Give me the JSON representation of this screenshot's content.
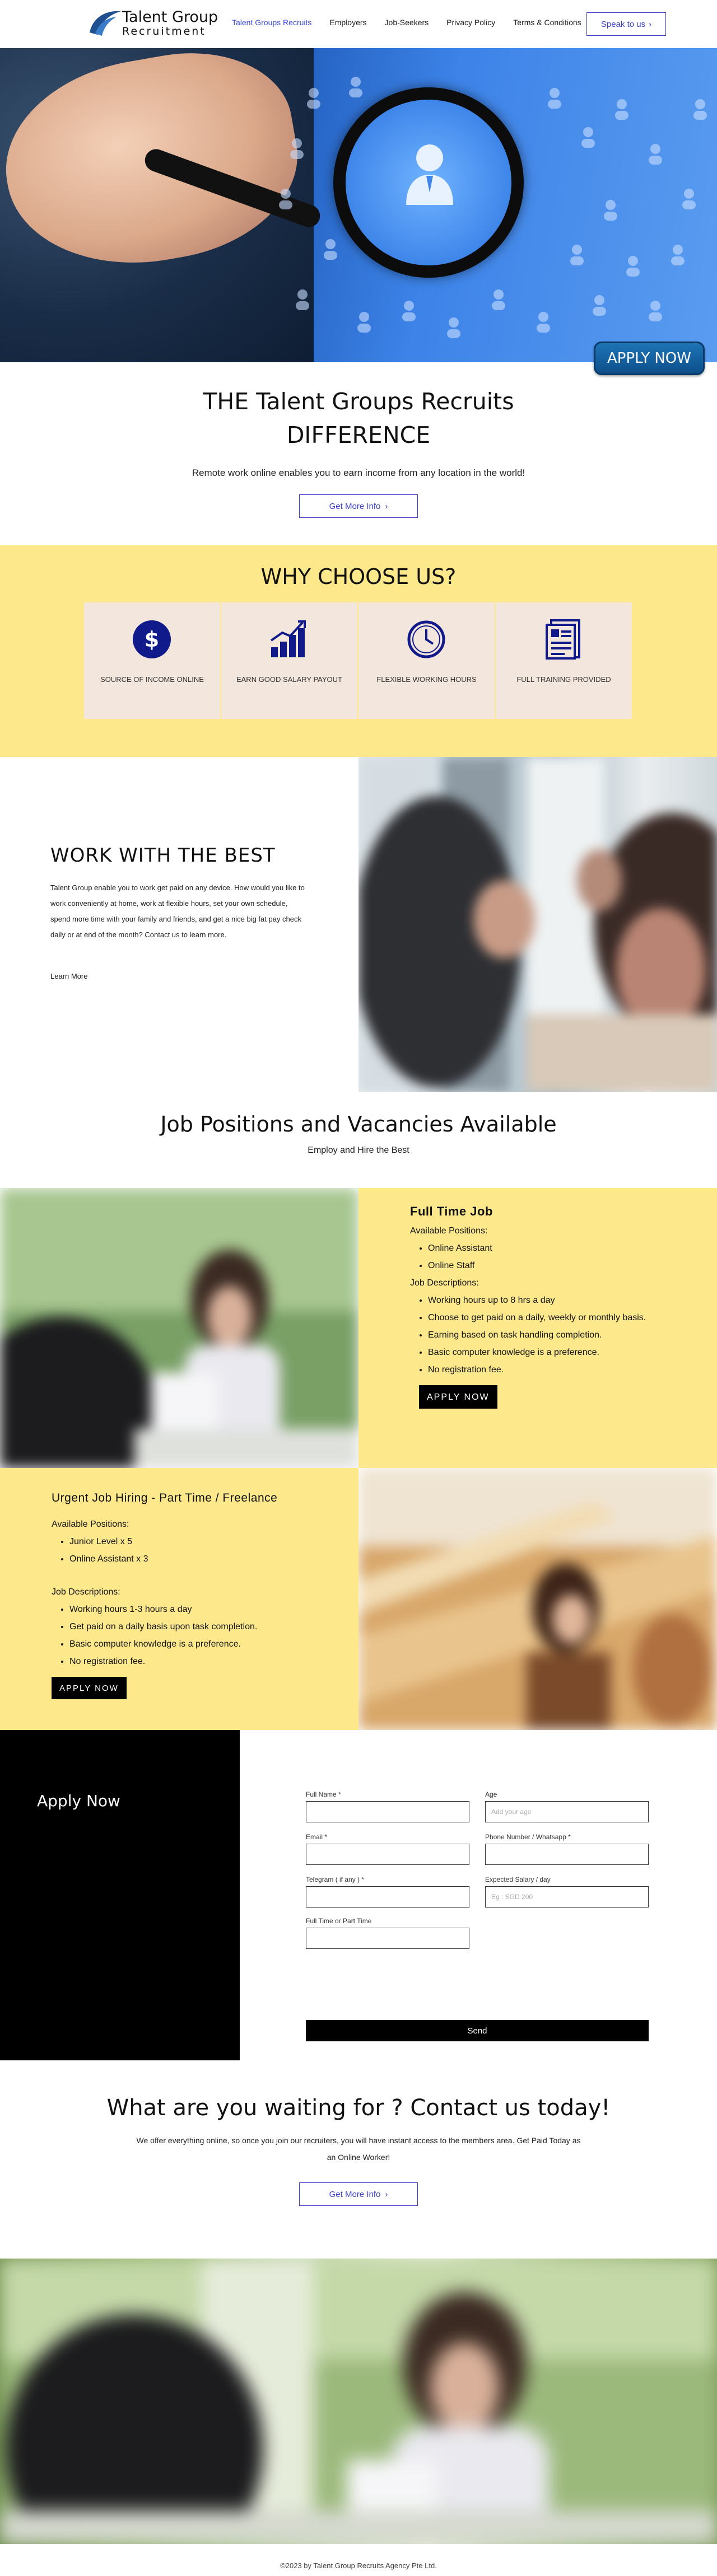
{
  "header": {
    "logo_line1": "Talent Group",
    "logo_line2": "Recruitment",
    "nav": [
      {
        "label": "Talent Groups Recruits",
        "active": true
      },
      {
        "label": "Employers",
        "active": false
      },
      {
        "label": "Job-Seekers",
        "active": false
      },
      {
        "label": "Privacy Policy",
        "active": false
      },
      {
        "label": "Terms & Conditions",
        "active": false
      }
    ],
    "speak_button": "Speak to us"
  },
  "hero": {
    "apply_now": "APPLY NOW"
  },
  "difference": {
    "title_line1": "THE Talent Groups Recruits",
    "title_line2": "DIFFERENCE",
    "subtitle": "Remote work online enables you to earn income from any location in the world!",
    "button": "Get More Info"
  },
  "why": {
    "title": "WHY CHOOSE US?",
    "cards": [
      {
        "label": "SOURCE OF INCOME ONLINE",
        "icon": "dollar-icon"
      },
      {
        "label": "EARN GOOD SALARY PAYOUT",
        "icon": "bar-chart-icon"
      },
      {
        "label": "FLEXIBLE WORKING HOURS",
        "icon": "clock-icon"
      },
      {
        "label": "FULL TRAINING PROVIDED",
        "icon": "document-icon"
      }
    ]
  },
  "work": {
    "title": "WORK WITH THE BEST",
    "body": "Talent Group enable you to work get paid on any device. How would you like to work conveniently at home, work at flexible hours, set your own schedule, spend more time with your family and friends, and get a nice big fat pay check daily or at end of the month? Contact us to learn more.",
    "learn_more": "Learn More"
  },
  "positions": {
    "title": "Job Positions and Vacancies Available",
    "subtitle": "Employ and Hire the Best"
  },
  "fulltime": {
    "title": "Full Time Job",
    "available_label": "Available Positions:",
    "positions": [
      "Online Assistant",
      "Online Staff"
    ],
    "desc_label": "Job Descriptions:",
    "descriptions": [
      "Working hours up to 8 hrs a day",
      "Choose to get paid on a daily, weekly or monthly basis.",
      "Earning based on task handling completion.",
      "Basic computer knowledge is a preference.",
      "No registration fee."
    ],
    "button": "APPLY NOW"
  },
  "urgent": {
    "title": "Urgent Job Hiring - Part Time / Freelance",
    "available_label": "Available Positions:",
    "positions": [
      "Junior Level x 5",
      "Online Assistant x 3"
    ],
    "desc_label": "Job Descriptions:",
    "descriptions": [
      "Working hours 1-3 hours a day",
      "Get paid on a daily basis upon task completion.",
      "Basic computer knowledge is a preference.",
      "No registration fee."
    ],
    "button": "APPLY NOW"
  },
  "form": {
    "title": "Apply Now",
    "full_name_label": "Full Name *",
    "age_label": "Age",
    "age_placeholder": "Add your age",
    "email_label": "Email *",
    "phone_label": "Phone Number / Whatsapp *",
    "telegram_label": "Telegram ( if any ) *",
    "salary_label": "Expected Salary / day",
    "salary_placeholder": "Eg : SGD 200",
    "jobtype_label": "Full Time or Part Time",
    "send": "Send"
  },
  "contact": {
    "title": "What are you waiting for ? Contact us  today!",
    "body": "We offer everything online, so once you join our recruiters, you will have instant access to the members area. Get Paid Today as an Online Worker!",
    "button": "Get More Info"
  },
  "footer": {
    "text": "©2023 by Talent Group Recruits Agency Pte Ltd."
  },
  "colors": {
    "accent": "#3c3fc9",
    "yellow": "#fde98c",
    "card": "#f3e6dc",
    "icon_navy": "#101a8a"
  }
}
